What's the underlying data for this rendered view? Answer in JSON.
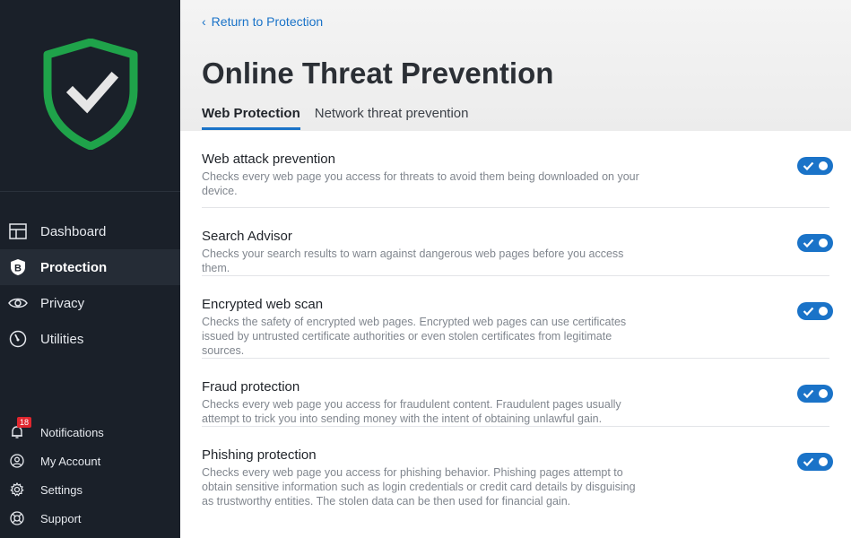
{
  "sidebar": {
    "nav": [
      {
        "label": "Dashboard",
        "icon": "dashboard-icon"
      },
      {
        "label": "Protection",
        "icon": "bitdefender-b-icon"
      },
      {
        "label": "Privacy",
        "icon": "eye-icon"
      },
      {
        "label": "Utilities",
        "icon": "gauge-icon"
      }
    ],
    "bottom": [
      {
        "label": "Notifications",
        "icon": "bell-icon",
        "badge": "18"
      },
      {
        "label": "My Account",
        "icon": "user-circle-icon"
      },
      {
        "label": "Settings",
        "icon": "gear-icon"
      },
      {
        "label": "Support",
        "icon": "lifebuoy-icon"
      }
    ]
  },
  "header": {
    "back_label": "Return to Protection",
    "title": "Online Threat Prevention",
    "tabs": [
      {
        "label": "Web Protection"
      },
      {
        "label": "Network threat prevention"
      }
    ]
  },
  "settings": [
    {
      "title": "Web attack prevention",
      "desc": "Checks every web page you access for threats to avoid them being downloaded on your device."
    },
    {
      "title": "Search Advisor",
      "desc": "Checks your search results to warn against dangerous web pages before you access them."
    },
    {
      "title": "Encrypted web scan",
      "desc": "Checks the safety of encrypted web pages. Encrypted web pages can use certificates issued by untrusted certificate authorities or even stolen certificates from legitimate sources."
    },
    {
      "title": "Fraud protection",
      "desc": "Checks every web page you access for fraudulent content. Fraudulent pages usually attempt to trick you into sending money with the intent of obtaining unlawful gain."
    },
    {
      "title": "Phishing protection",
      "desc": "Checks every web page you access for phishing behavior. Phishing pages attempt to obtain sensitive information such as login credentials or credit card details by disguising as trustworthy entities. The stolen data can be then used for financial gain."
    }
  ],
  "colors": {
    "accent": "#1a73c8",
    "sidebar_bg": "#1a2029",
    "shield_green": "#1fa34a"
  }
}
